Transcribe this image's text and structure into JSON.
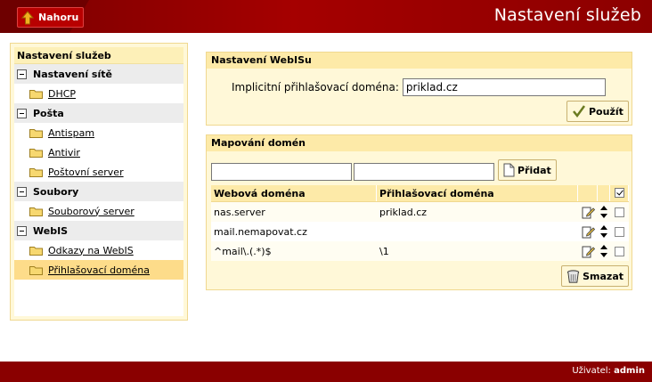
{
  "header": {
    "up_button": "Nahoru",
    "title": "Nastavení služeb"
  },
  "tree": {
    "title": "Nastavení služeb",
    "groups": [
      {
        "label": "Nastavení sítě",
        "items": [
          {
            "label": "DHCP"
          }
        ]
      },
      {
        "label": "Pošta",
        "items": [
          {
            "label": "Antispam"
          },
          {
            "label": "Antivir"
          },
          {
            "label": "Poštovní server"
          }
        ]
      },
      {
        "label": "Soubory",
        "items": [
          {
            "label": "Souborový server"
          }
        ]
      },
      {
        "label": "WebIS",
        "items": [
          {
            "label": "Odkazy na WebIS"
          },
          {
            "label": "Přihlašovací doména",
            "selected": true
          }
        ]
      }
    ]
  },
  "webis_panel": {
    "title": "Nastavení WebISu",
    "field_label": "Implicitní přihlašovací doména:",
    "field_value": "priklad.cz",
    "apply_button": "Použít"
  },
  "mapping_panel": {
    "title": "Mapování domén",
    "input1_value": "",
    "input2_value": "",
    "add_button": "Přidat",
    "columns": [
      "Webová doména",
      "Přihlašovací doména"
    ],
    "rows": [
      {
        "web": "nas.server",
        "login": "priklad.cz"
      },
      {
        "web": "mail.nemapovat.cz",
        "login": ""
      },
      {
        "web": "^mail\\.(.*)$",
        "login": "\\1"
      }
    ],
    "delete_button": "Smazat"
  },
  "footer": {
    "user_label": "Uživatel:",
    "user_name": "admin"
  },
  "colors": {
    "header_red": "#a50000",
    "footer_red": "#8a0000",
    "panel_bg": "#fff8d8",
    "panel_title_bg": "#fdeaa8",
    "selected_bg": "#fddc8a"
  }
}
